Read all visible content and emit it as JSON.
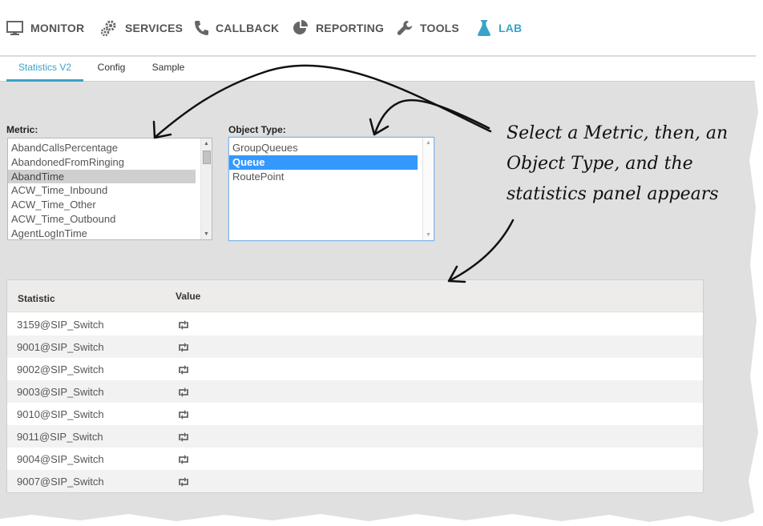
{
  "nav": {
    "items": [
      {
        "label": "MONITOR",
        "icon": "monitor-icon"
      },
      {
        "label": "SERVICES",
        "icon": "gears-icon"
      },
      {
        "label": "CALLBACK",
        "icon": "phone-icon"
      },
      {
        "label": "REPORTING",
        "icon": "pie-chart-icon"
      },
      {
        "label": "TOOLS",
        "icon": "wrench-icon"
      },
      {
        "label": "LAB",
        "icon": "flask-icon"
      }
    ],
    "active": "LAB",
    "accent_color": "#3aa3c9"
  },
  "tabs": [
    {
      "label": "Statistics V2",
      "active": true
    },
    {
      "label": "Config",
      "active": false
    },
    {
      "label": "Sample",
      "active": false
    }
  ],
  "metric": {
    "label": "Metric:",
    "options": [
      "AbandCallsPercentage",
      "AbandonedFromRinging",
      "AbandTime",
      "ACW_Time_Inbound",
      "ACW_Time_Other",
      "ACW_Time_Outbound",
      "AgentLogInTime"
    ],
    "selected": "AbandTime"
  },
  "object_type": {
    "label": "Object Type:",
    "options": [
      "GroupQueues",
      "Queue",
      "RoutePoint"
    ],
    "selected": "Queue"
  },
  "stats_table": {
    "columns": [
      "Statistic",
      "Value"
    ],
    "rows": [
      {
        "statistic": "3159@SIP_Switch",
        "value_icon": "refresh-icon"
      },
      {
        "statistic": "9001@SIP_Switch",
        "value_icon": "refresh-icon"
      },
      {
        "statistic": "9002@SIP_Switch",
        "value_icon": "refresh-icon"
      },
      {
        "statistic": "9003@SIP_Switch",
        "value_icon": "refresh-icon"
      },
      {
        "statistic": "9010@SIP_Switch",
        "value_icon": "refresh-icon"
      },
      {
        "statistic": "9011@SIP_Switch",
        "value_icon": "refresh-icon"
      },
      {
        "statistic": "9004@SIP_Switch",
        "value_icon": "refresh-icon"
      },
      {
        "statistic": "9007@SIP_Switch",
        "value_icon": "refresh-icon"
      }
    ]
  },
  "annotation": {
    "lines": [
      "Select a Metric, then, an",
      "Object Type, and the",
      "statistics panel appears"
    ]
  }
}
